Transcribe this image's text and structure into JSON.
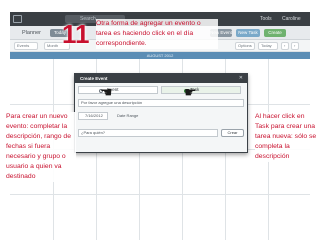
{
  "topbar": {
    "search_placeholder": "Search",
    "link_a": "Tools",
    "link_b": "Caroline"
  },
  "planner": {
    "title": "Planner",
    "tab_active": "Today",
    "btn_a": "New Event",
    "btn_b": "New Task",
    "btn_c": "Create"
  },
  "filters": {
    "chip_a": "Events",
    "chip_b": "Month",
    "chip_c": "Options",
    "chip_d": "Today",
    "chip_e": "‹",
    "chip_f": "›"
  },
  "month": {
    "label": "AUGUST 2012"
  },
  "annotation": {
    "number": "11",
    "top_text": "Otra forma de agregar un evento o tarea es haciendo click en el día correspondiente.",
    "left_text": "Para crear un nuevo evento: completar la descripción, rango de fechas si fuera necesario y grupo o usuario a quien va destinado",
    "right_text": "Al hacer click en Task para crear una tarea nueva: sólo se completa la descripción"
  },
  "modal": {
    "title": "Create Event",
    "close": "✕",
    "option_event": "Event",
    "option_task": "Task",
    "description_placeholder": "Por favor agregue una descripción",
    "date_value": "7/16/2012",
    "date_range_label": "Date Range",
    "who_placeholder": "¿Para quién?",
    "create_button": "Crear"
  },
  "icons": {
    "pointing": "hand-pointing-icon",
    "calendar": "calendar-icon",
    "close": "close-icon"
  },
  "colors": {
    "annotation_red": "#c8102e",
    "topbar": "#3a3f44",
    "month_header": "#5b8db5"
  }
}
